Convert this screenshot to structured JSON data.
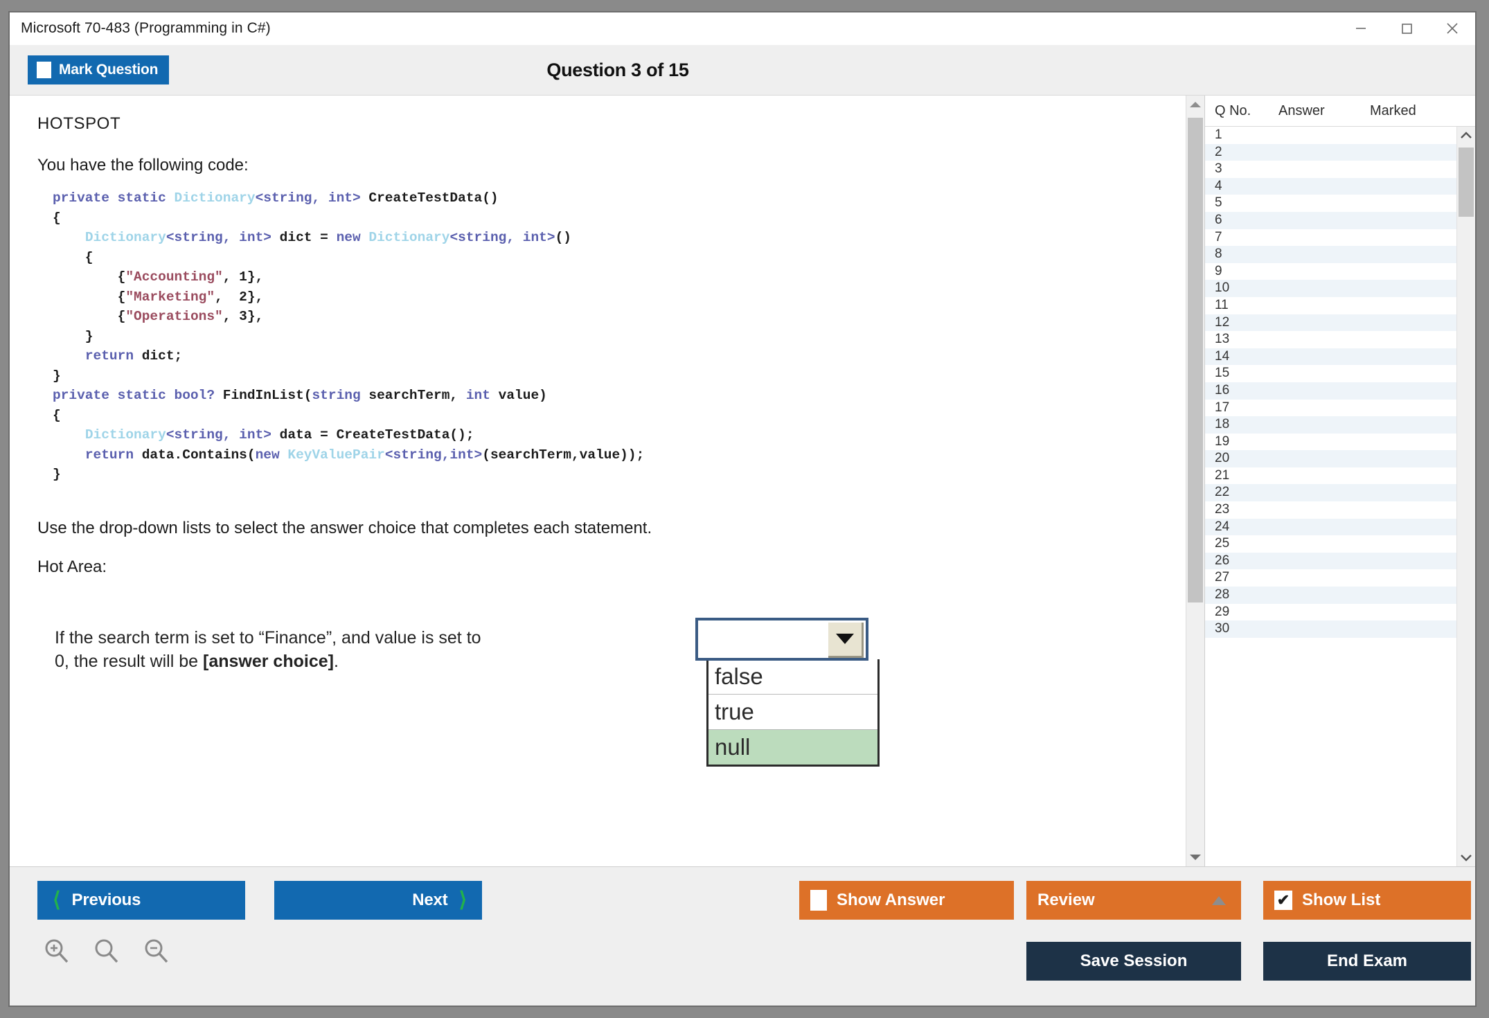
{
  "window": {
    "title": "Microsoft 70-483 (Programming in C#)",
    "controls": {
      "minimize": "minimize-icon",
      "maximize": "maximize-icon",
      "close": "close-icon"
    }
  },
  "header": {
    "mark_question_label": "Mark Question",
    "question_title": "Question 3 of 15"
  },
  "question": {
    "type_label": "HOTSPOT",
    "intro": "You have the following code:",
    "code_lines": [
      [
        {
          "t": "private static ",
          "c": "kw"
        },
        {
          "t": "Dictionary",
          "c": "typ"
        },
        {
          "t": "<string, int> ",
          "c": "kw"
        },
        {
          "t": "CreateTestData()",
          "c": "pl"
        }
      ],
      [
        {
          "t": "{",
          "c": "pl"
        }
      ],
      [
        {
          "t": "    ",
          "c": "pl"
        },
        {
          "t": "Dictionary",
          "c": "typ"
        },
        {
          "t": "<string, int> ",
          "c": "kw"
        },
        {
          "t": "dict = ",
          "c": "pl"
        },
        {
          "t": "new ",
          "c": "kw"
        },
        {
          "t": "Dictionary",
          "c": "typ"
        },
        {
          "t": "<string, int>",
          "c": "kw"
        },
        {
          "t": "()",
          "c": "pl"
        }
      ],
      [
        {
          "t": "    {",
          "c": "pl"
        }
      ],
      [
        {
          "t": "        {",
          "c": "pl"
        },
        {
          "t": "\"Accounting\"",
          "c": "str"
        },
        {
          "t": ", 1},",
          "c": "pl"
        }
      ],
      [
        {
          "t": "        {",
          "c": "pl"
        },
        {
          "t": "\"Marketing\"",
          "c": "str"
        },
        {
          "t": ",  2},",
          "c": "pl"
        }
      ],
      [
        {
          "t": "        {",
          "c": "pl"
        },
        {
          "t": "\"Operations\"",
          "c": "str"
        },
        {
          "t": ", 3},",
          "c": "pl"
        }
      ],
      [
        {
          "t": "    }",
          "c": "pl"
        }
      ],
      [
        {
          "t": "    ",
          "c": "pl"
        },
        {
          "t": "return ",
          "c": "kw"
        },
        {
          "t": "dict;",
          "c": "pl"
        }
      ],
      [
        {
          "t": "}",
          "c": "pl"
        }
      ],
      [
        {
          "t": "private static bool? ",
          "c": "kw"
        },
        {
          "t": "FindInList(",
          "c": "pl"
        },
        {
          "t": "string ",
          "c": "kw"
        },
        {
          "t": "searchTerm, ",
          "c": "pl"
        },
        {
          "t": "int ",
          "c": "kw"
        },
        {
          "t": "value)",
          "c": "pl"
        }
      ],
      [
        {
          "t": "{",
          "c": "pl"
        }
      ],
      [
        {
          "t": "    ",
          "c": "pl"
        },
        {
          "t": "Dictionary",
          "c": "typ"
        },
        {
          "t": "<string, int> ",
          "c": "kw"
        },
        {
          "t": "data = CreateTestData();",
          "c": "pl"
        }
      ],
      [
        {
          "t": "    ",
          "c": "pl"
        },
        {
          "t": "return ",
          "c": "kw"
        },
        {
          "t": "data.Contains(",
          "c": "pl"
        },
        {
          "t": "new ",
          "c": "kw"
        },
        {
          "t": "KeyValuePair",
          "c": "typ"
        },
        {
          "t": "<string,int>",
          "c": "kw"
        },
        {
          "t": "(searchTerm,value));",
          "c": "pl"
        }
      ],
      [
        {
          "t": "}",
          "c": "pl"
        }
      ]
    ],
    "instruction": "Use the drop-down lists to select the answer choice that completes each statement.",
    "hot_area_label": "Hot Area:",
    "statement_part1": "If the search term is set to “Finance”, and value is set to 0, the result will be ",
    "statement_bold": "[answer choice]",
    "statement_part2": ".",
    "dropdown": {
      "selected_value": "",
      "options": [
        "false",
        "true",
        "null"
      ],
      "highlighted": "null",
      "arrow_icon": "chevron-down-icon"
    }
  },
  "review_panel": {
    "columns": [
      "Q No.",
      "Answer",
      "Marked"
    ],
    "rows": [
      {
        "q": "1",
        "answer": "",
        "marked": ""
      },
      {
        "q": "2",
        "answer": "",
        "marked": ""
      },
      {
        "q": "3",
        "answer": "",
        "marked": ""
      },
      {
        "q": "4",
        "answer": "",
        "marked": ""
      },
      {
        "q": "5",
        "answer": "",
        "marked": ""
      },
      {
        "q": "6",
        "answer": "",
        "marked": ""
      },
      {
        "q": "7",
        "answer": "",
        "marked": ""
      },
      {
        "q": "8",
        "answer": "",
        "marked": ""
      },
      {
        "q": "9",
        "answer": "",
        "marked": ""
      },
      {
        "q": "10",
        "answer": "",
        "marked": ""
      },
      {
        "q": "11",
        "answer": "",
        "marked": ""
      },
      {
        "q": "12",
        "answer": "",
        "marked": ""
      },
      {
        "q": "13",
        "answer": "",
        "marked": ""
      },
      {
        "q": "14",
        "answer": "",
        "marked": ""
      },
      {
        "q": "15",
        "answer": "",
        "marked": ""
      },
      {
        "q": "16",
        "answer": "",
        "marked": ""
      },
      {
        "q": "17",
        "answer": "",
        "marked": ""
      },
      {
        "q": "18",
        "answer": "",
        "marked": ""
      },
      {
        "q": "19",
        "answer": "",
        "marked": ""
      },
      {
        "q": "20",
        "answer": "",
        "marked": ""
      },
      {
        "q": "21",
        "answer": "",
        "marked": ""
      },
      {
        "q": "22",
        "answer": "",
        "marked": ""
      },
      {
        "q": "23",
        "answer": "",
        "marked": ""
      },
      {
        "q": "24",
        "answer": "",
        "marked": ""
      },
      {
        "q": "25",
        "answer": "",
        "marked": ""
      },
      {
        "q": "26",
        "answer": "",
        "marked": ""
      },
      {
        "q": "27",
        "answer": "",
        "marked": ""
      },
      {
        "q": "28",
        "answer": "",
        "marked": ""
      },
      {
        "q": "29",
        "answer": "",
        "marked": ""
      },
      {
        "q": "30",
        "answer": "",
        "marked": ""
      }
    ]
  },
  "footer": {
    "previous_label": "Previous",
    "next_label": "Next",
    "show_answer_label": "Show Answer",
    "show_answer_checked": false,
    "review_label": "Review",
    "show_list_label": "Show List",
    "show_list_checked": true,
    "show_list_check_glyph": "✔",
    "save_session_label": "Save Session",
    "end_exam_label": "End Exam",
    "zoom_icons": [
      "zoom-in-icon",
      "zoom-reset-icon",
      "zoom-out-icon"
    ]
  },
  "colors": {
    "primary_blue": "#1269b0",
    "orange": "#dd7128",
    "dark_navy": "#1d3247",
    "green_accent": "#22b14c",
    "dropdown_highlight": "#bcdcbd"
  }
}
